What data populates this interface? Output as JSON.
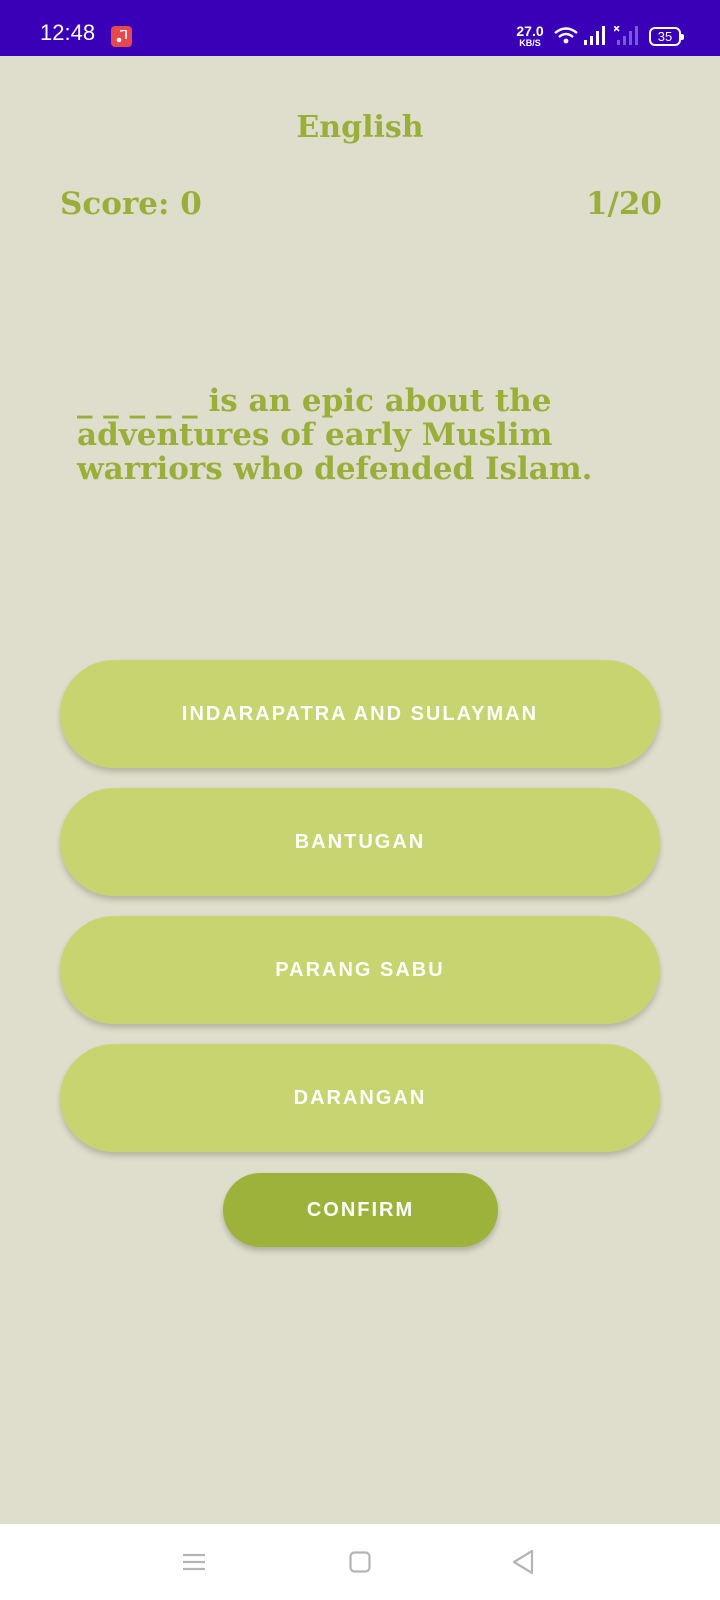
{
  "status_bar": {
    "time": "12:48",
    "net_speed_value": "27.0",
    "net_speed_unit": "KB/S",
    "battery_level": "35",
    "icons": [
      "music-app-icon",
      "wifi-icon",
      "signal-icon",
      "signal-no-sim-icon",
      "battery-icon"
    ]
  },
  "app": {
    "title": "English",
    "score_label": "Score: 0",
    "progress": "1/20"
  },
  "question": {
    "text": "_ _ _ _ _ is an epic about the adventures of early Muslim warriors who defended Islam."
  },
  "options": [
    {
      "label": "INDARAPATRA AND SULAYMAN"
    },
    {
      "label": "BANTUGAN"
    },
    {
      "label": "PARANG SABU"
    },
    {
      "label": "DARANGAN"
    }
  ],
  "confirm_label": "CONFIRM",
  "colors": {
    "status_bar": "#3a00b8",
    "background": "#dfddcb",
    "accent_text": "#9aaf3a",
    "option_button": "#c7d470",
    "confirm_button": "#9cb23a"
  },
  "nav_bar": {
    "icons": [
      "recents-icon",
      "home-icon",
      "back-icon"
    ]
  }
}
